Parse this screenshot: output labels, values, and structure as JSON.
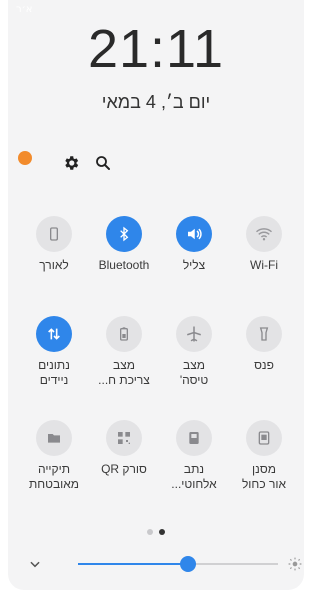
{
  "status": {
    "carrier": "א׳ר"
  },
  "clock": {
    "time": "21:11",
    "date": "יום ב׳, 4 במאי"
  },
  "toolbar": {
    "icons": [
      "notification-dot",
      "settings-gear",
      "search"
    ]
  },
  "tiles": [
    {
      "id": "torch-off",
      "label": "לאורך",
      "icon": "rotation-lock-icon",
      "on": false
    },
    {
      "id": "bluetooth",
      "label": "Bluetooth",
      "icon": "bluetooth-icon",
      "on": true
    },
    {
      "id": "sound",
      "label": "צליל",
      "icon": "volume-icon",
      "on": true
    },
    {
      "id": "wifi",
      "label": "Wi-Fi",
      "icon": "wifi-icon",
      "on": false
    },
    {
      "id": "mobile-data",
      "label": "נתונים\nניידים",
      "icon": "data-arrows-icon",
      "on": true
    },
    {
      "id": "power-saving",
      "label": "מצב\nצריכת ח...",
      "icon": "battery-icon",
      "on": false
    },
    {
      "id": "airplane",
      "label": "מצב\nטיסה'",
      "icon": "airplane-icon",
      "on": false
    },
    {
      "id": "flashlight",
      "label": "פנס",
      "icon": "flashlight-icon",
      "on": false
    },
    {
      "id": "secure-folder",
      "label": "תיקייה\nמאובטחת",
      "icon": "folder-icon",
      "on": false
    },
    {
      "id": "qr-scanner",
      "label": "סורק QR",
      "icon": "qr-icon",
      "on": false
    },
    {
      "id": "wireless-sharing",
      "label": "נתב\nאלחוטי...",
      "icon": "share-icon",
      "on": false
    },
    {
      "id": "blue-light",
      "label": "מסנן\nאור כחול",
      "icon": "screen-filter-icon",
      "on": false
    }
  ],
  "pager": {
    "pages": 2,
    "current": 2
  },
  "brightness": {
    "level_percent": 55
  },
  "colors": {
    "accent": "#2f86ea",
    "panel": "#f4f4f5",
    "notification": "#f28b2c"
  }
}
